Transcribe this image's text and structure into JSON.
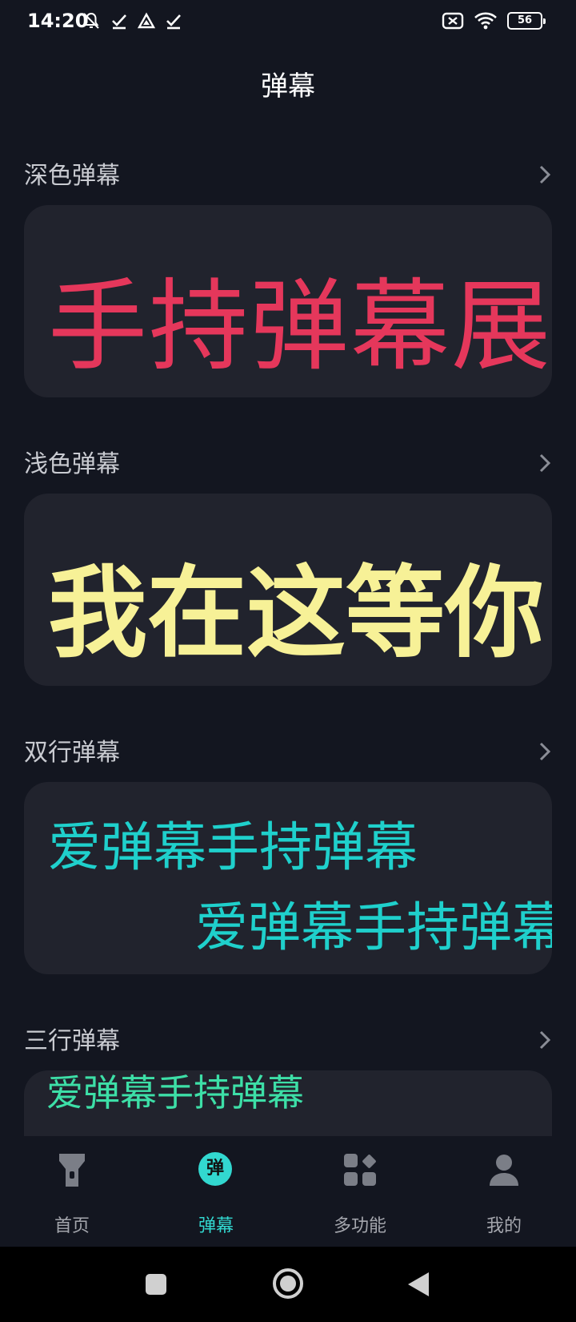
{
  "status_bar": {
    "time": "14:20",
    "battery": "56"
  },
  "header": {
    "title": "弹幕"
  },
  "sections": [
    {
      "label": "深色弹幕",
      "preview_lines": [
        "手持弹幕展示"
      ],
      "color": "#e5375b"
    },
    {
      "label": "浅色弹幕",
      "preview_lines": [
        "我在这等你"
      ],
      "color": "#f7f197"
    },
    {
      "label": "双行弹幕",
      "preview_lines": [
        "爱弹幕手持弹幕",
        "爱弹幕手持弹幕"
      ],
      "color": "#1fd0cc"
    },
    {
      "label": "三行弹幕",
      "preview_lines": [
        "爱弹幕手持弹幕"
      ],
      "color": "#3ddfa7"
    }
  ],
  "bottom_nav": {
    "items": [
      {
        "label": "首页",
        "icon": "flashlight-icon"
      },
      {
        "label": "弹幕",
        "icon": "danmaku-badge-icon",
        "badge": "弹",
        "active": true
      },
      {
        "label": "多功能",
        "icon": "grid-apps-icon"
      },
      {
        "label": "我的",
        "icon": "user-icon"
      }
    ]
  },
  "colors": {
    "background": "#131620",
    "card": "#21232d",
    "accent": "#32d8d0"
  }
}
